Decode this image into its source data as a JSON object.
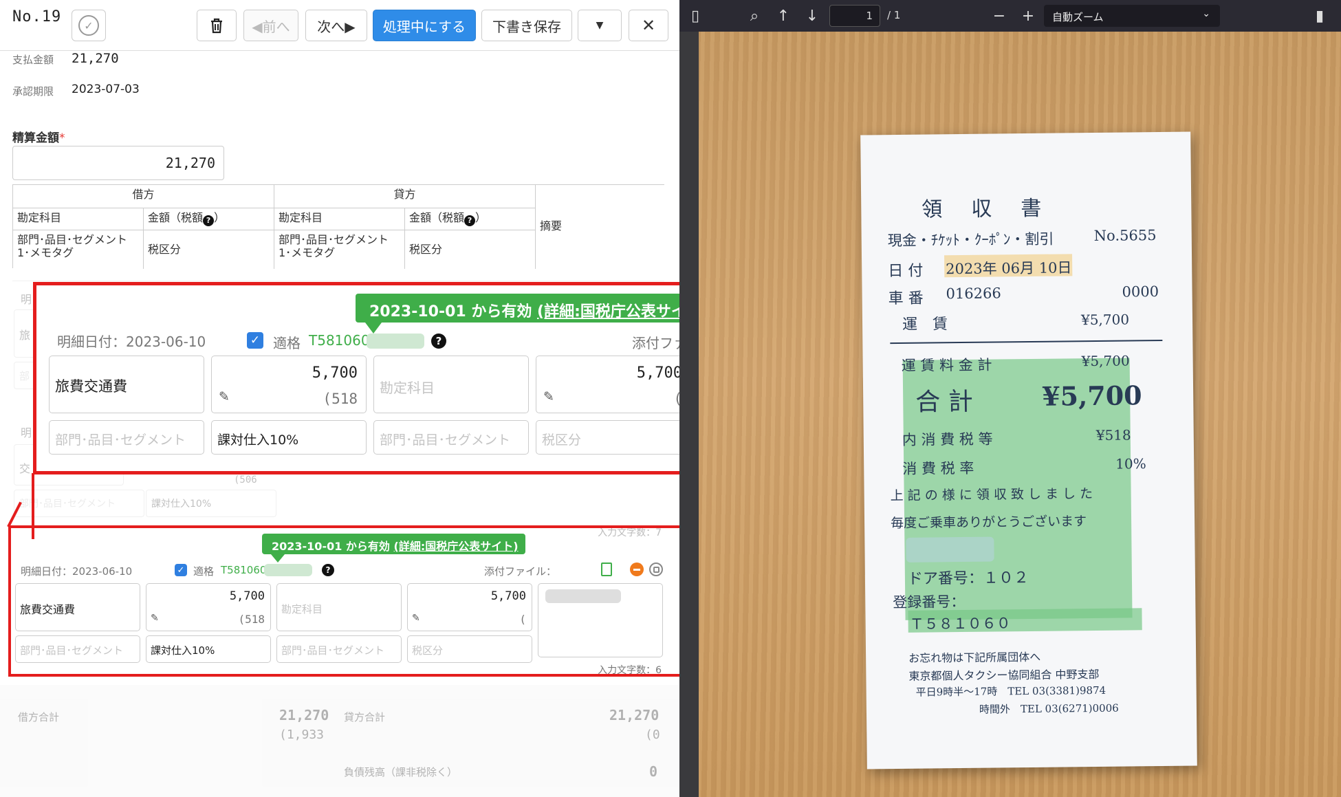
{
  "toolbar": {
    "doc_no": "No.19",
    "prev_label": "◀前へ",
    "next_label": "次へ▶",
    "process_label": "処理中にする",
    "draft_label": "下書き保存"
  },
  "summary": {
    "payment_label": "支払金額",
    "payment_value": "21,270",
    "due_label": "承認期限",
    "due_value": "2023-07-03"
  },
  "settlement": {
    "label": "精算金額",
    "required_mark": "*",
    "value": "21,270"
  },
  "journal_header": {
    "debit": "借方",
    "credit": "貸方",
    "account": "勘定科目",
    "amount_tax": "金額（税額",
    "amount_tax_close": "）",
    "dept": "部門･品目･セグメント",
    "dept2": "1･メモタグ",
    "tax_class": "税区分",
    "memo": "摘要"
  },
  "line_item": {
    "valid_badge_text": "2023-10-01 から有効 ",
    "valid_badge_link": "(詳細:国税庁公表サイト)",
    "date_label": "明細日付：2023-06-10",
    "qualified_label": "適格",
    "reg_number": "T581060",
    "attach_label": "添付ファイル：",
    "account": "旅費交通費",
    "debit_amount": "5,700",
    "debit_tax": "(518",
    "credit_account_placeholder": "勘定科目",
    "credit_amount": "5,700",
    "credit_tax": "(",
    "dept_placeholder": "部門･品目･セグメント",
    "tax_class": "課対仕入10%",
    "tax_class_placeholder": "税区分",
    "char_count": "入力文字数：6",
    "char_count_faded": "入力文字数：7"
  },
  "faded_rows": {
    "row_prefix1": "明",
    "row_prefix2": "旅",
    "row_prefix3": "部",
    "row_prefix4": "明",
    "row_prefix5": "交",
    "tax_partial": "(506",
    "tax_class": "課対仕入10%",
    "dept_placeholder": "部門･品目･セグメント"
  },
  "totals": {
    "debit_label": "借方合計",
    "debit_total": "21,270",
    "debit_tax": "(1,933",
    "credit_label": "貸方合計",
    "credit_total": "21,270",
    "credit_tax": "(0",
    "diff_label": "負債残高（課非税除く）",
    "diff_value": "0"
  },
  "pdf_viewer": {
    "page_current": "1",
    "page_total": "/ 1",
    "zoom": "自動ズーム"
  },
  "receipt": {
    "title": "領　収　書",
    "line1": "現金・ﾁｹｯﾄ・ｸｰﾎﾟﾝ・割引",
    "no": "No.5655",
    "date_label": "日 付",
    "date_value": "2023年 06月 10日",
    "car_label": "車 番",
    "car_value": "016266",
    "car_code": "0000",
    "fare_label": "運　賃",
    "fare_value": "¥5,700",
    "fare_total_label": "運 賃 料 金 計",
    "fare_total_value": "¥5,700",
    "total_label": "合 計",
    "total_value": "¥5,700",
    "tax_label": "内 消 費 税 等",
    "tax_value": "¥518",
    "rate_label": "消 費 税 率",
    "rate_value": "10%",
    "msg1": "上 記 の 様 に 領 収 致 し ま し た",
    "msg2": "毎度ご乗車ありがとうございます",
    "door_label": "ドア番号：１０２",
    "reg_label": "登録番号：",
    "reg_value": "Ｔ５８１０６０",
    "footer1": "お忘れ物は下記所属団体へ",
    "footer2": "東京都個人タクシー協同組合 中野支部",
    "footer3": "平日9時半～17時　TEL 03(3381)9874",
    "footer4": "時間外　TEL 03(6271)0006"
  },
  "colors": {
    "primary_button": "#2f8ce8",
    "highlight_border": "#e41d1d",
    "valid_badge": "#3fae49"
  }
}
